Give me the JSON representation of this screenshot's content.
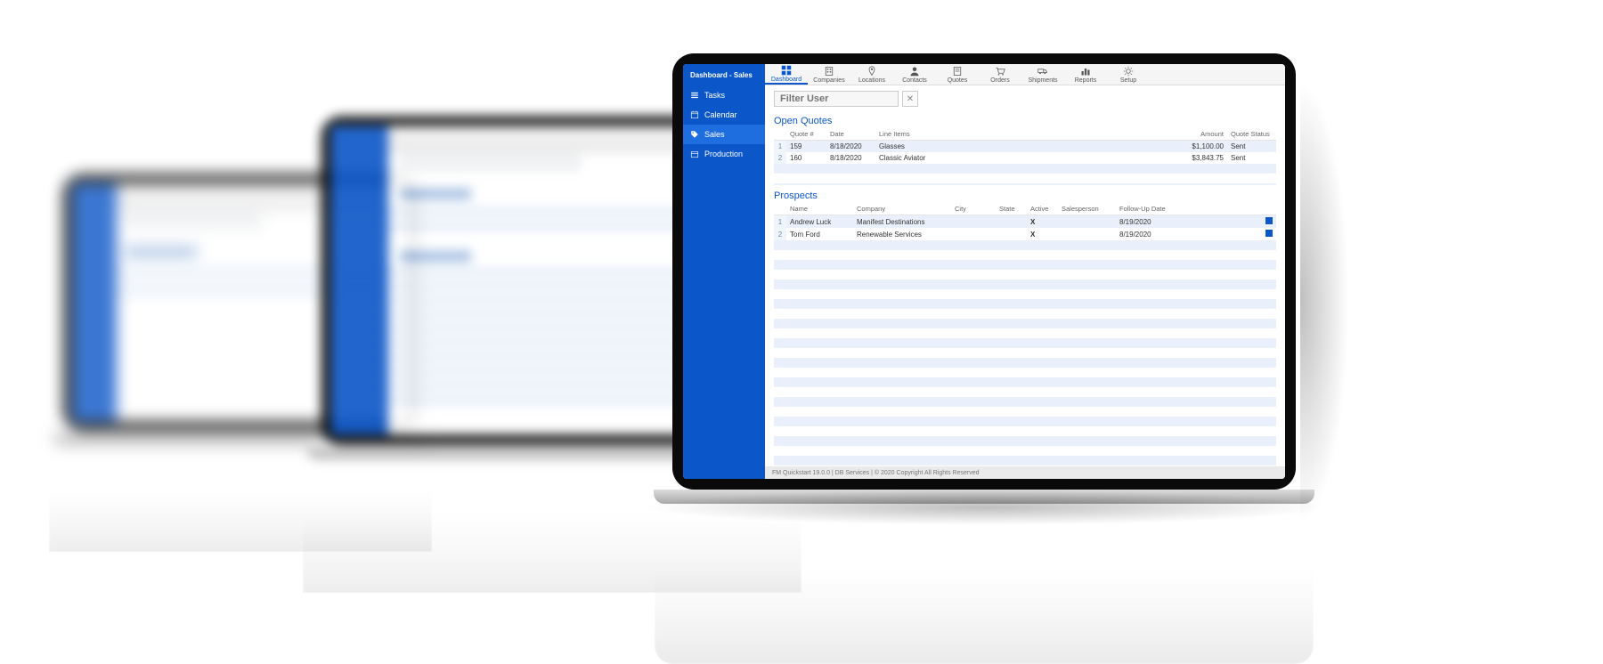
{
  "app_title": "Dashboard - Sales",
  "nav": [
    {
      "label": "Dashboard",
      "active": true,
      "icon": "dashboard"
    },
    {
      "label": "Companies",
      "icon": "building"
    },
    {
      "label": "Locations",
      "icon": "pin"
    },
    {
      "label": "Contacts",
      "icon": "person"
    },
    {
      "label": "Quotes",
      "icon": "doc"
    },
    {
      "label": "Orders",
      "icon": "cart"
    },
    {
      "label": "Shipments",
      "icon": "truck"
    },
    {
      "label": "Reports",
      "icon": "bars"
    },
    {
      "label": "Setup",
      "icon": "gear"
    }
  ],
  "sidebar": [
    {
      "label": "Tasks",
      "icon": "list"
    },
    {
      "label": "Calendar",
      "icon": "calendar"
    },
    {
      "label": "Sales",
      "icon": "tag",
      "active": true
    },
    {
      "label": "Production",
      "icon": "box"
    }
  ],
  "filter": {
    "placeholder": "Filter User"
  },
  "open_quotes": {
    "title": "Open Quotes",
    "headers": [
      "Quote #",
      "Date",
      "Line Items",
      "Amount",
      "Quote Status"
    ],
    "rows": [
      {
        "idx": "1",
        "quote": "159",
        "date": "8/18/2020",
        "items": "Glasses",
        "amount": "$1,100.00",
        "status": "Sent"
      },
      {
        "idx": "2",
        "quote": "160",
        "date": "8/18/2020",
        "items": "Classic Aviator",
        "amount": "$3,843.75",
        "status": "Sent"
      }
    ]
  },
  "prospects": {
    "title": "Prospects",
    "headers": [
      "Name",
      "Company",
      "City",
      "State",
      "Active",
      "Salesperson",
      "Follow-Up Date"
    ],
    "rows": [
      {
        "idx": "1",
        "name": "Andrew Luck",
        "company": "Manifest Destinations",
        "city": "",
        "state": "",
        "active": "X",
        "sales": "",
        "follow": "8/19/2020"
      },
      {
        "idx": "2",
        "name": "Tom Ford",
        "company": "Renewable Services",
        "city": "",
        "state": "",
        "active": "X",
        "sales": "",
        "follow": "8/19/2020"
      }
    ]
  },
  "footer": "FM Quickstart 19.0.0 | DB Services | © 2020 Copyright All Rights Reserved"
}
